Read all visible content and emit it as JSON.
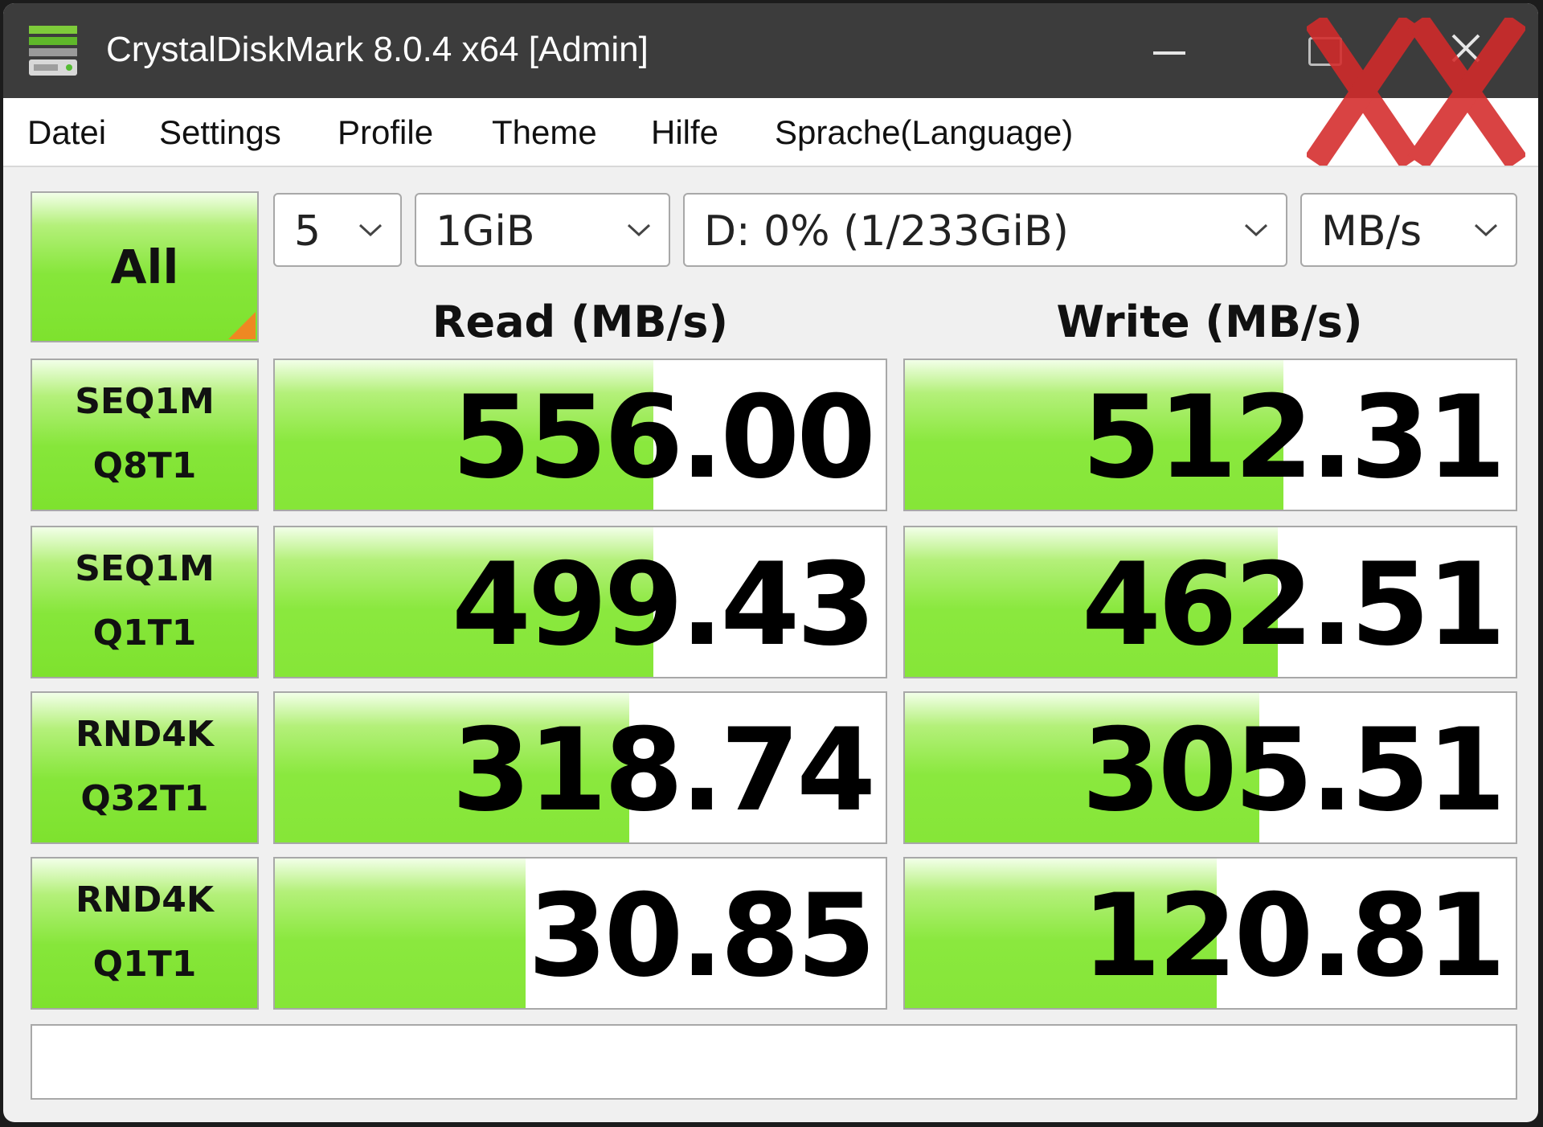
{
  "window": {
    "title": "CrystalDiskMark 8.0.4 x64 [Admin]"
  },
  "menu": {
    "items": [
      "Datei",
      "Settings",
      "Profile",
      "Theme",
      "Hilfe",
      "Sprache(Language)"
    ]
  },
  "controls": {
    "all_label": "All",
    "count": "5",
    "size": "1GiB",
    "drive": "D: 0% (1/233GiB)",
    "unit": "MB/s"
  },
  "headers": {
    "read": "Read (MB/s)",
    "write": "Write (MB/s)"
  },
  "tests": [
    {
      "line1": "SEQ1M",
      "line2": "Q8T1",
      "read": "556.00",
      "write": "512.31",
      "read_fill": 0.62,
      "write_fill": 0.62
    },
    {
      "line1": "SEQ1M",
      "line2": "Q1T1",
      "read": "499.43",
      "write": "462.51",
      "read_fill": 0.62,
      "write_fill": 0.61
    },
    {
      "line1": "RND4K",
      "line2": "Q32T1",
      "read": "318.74",
      "write": "305.51",
      "read_fill": 0.58,
      "write_fill": 0.58
    },
    {
      "line1": "RND4K",
      "line2": "Q1T1",
      "read": "30.85",
      "write": "120.81",
      "read_fill": 0.41,
      "write_fill": 0.51
    }
  ],
  "comment": "",
  "colors": {
    "bar_green": "#86e638",
    "titlebar": "#3c3c3c",
    "corner_orange": "#ee8822",
    "watermark_red": "#d42a2a"
  },
  "icons": [
    "crystaldiskmark-app-icon",
    "minimize-icon",
    "maximize-icon",
    "close-icon",
    "chevron-down-icon",
    "hardwareluxx-xx-logo"
  ]
}
